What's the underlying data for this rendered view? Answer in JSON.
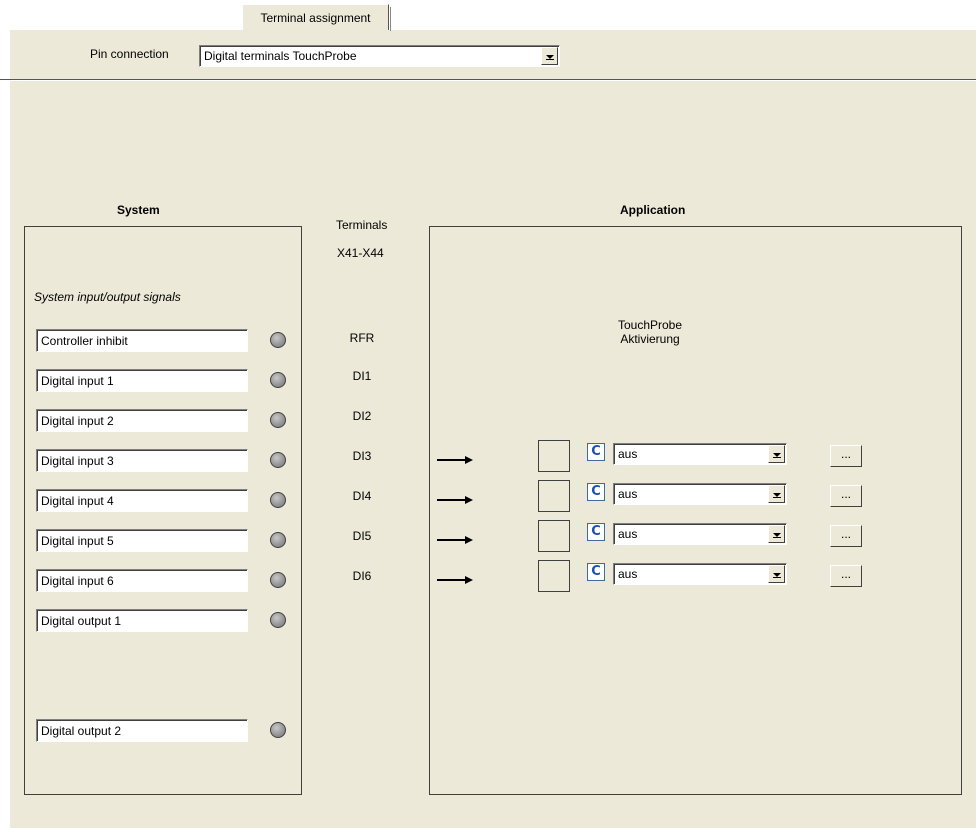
{
  "tab": {
    "label": "Terminal assignment"
  },
  "pin_connection": {
    "label": "Pin connection",
    "value": "Digital terminals TouchProbe"
  },
  "system": {
    "heading": "System",
    "subheading": "System input/output signals",
    "signals": [
      "Controller inhibit",
      "Digital input 1",
      "Digital input 2",
      "Digital input 3",
      "Digital input 4",
      "Digital input 5",
      "Digital input 6",
      "Digital output 1",
      "Digital output 2"
    ]
  },
  "terminals": {
    "heading": "Terminals",
    "range": "X41-X44",
    "labels": [
      "RFR",
      "DI1",
      "DI2",
      "DI3",
      "DI4",
      "DI5",
      "DI6"
    ]
  },
  "application": {
    "heading": "Application",
    "function_title": "TouchProbe\nAktivierung",
    "rows": [
      {
        "icon_text": "C",
        "value": "aus",
        "button": "..."
      },
      {
        "icon_text": "C",
        "value": "aus",
        "button": "..."
      },
      {
        "icon_text": "C",
        "value": "aus",
        "button": "..."
      },
      {
        "icon_text": "C",
        "value": "aus",
        "button": "..."
      }
    ]
  }
}
